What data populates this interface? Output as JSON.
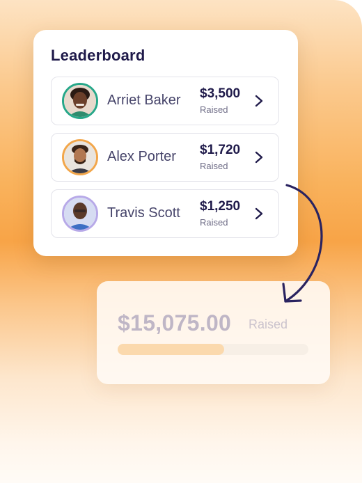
{
  "leaderboard": {
    "title": "Leaderboard",
    "entries": [
      {
        "name": "Arriet Baker",
        "amount": "$3,500",
        "label": "Raised",
        "ring_color": "#27a789"
      },
      {
        "name": "Alex Porter",
        "amount": "$1,720",
        "label": "Raised",
        "ring_color": "#f2a64a"
      },
      {
        "name": "Travis Scott",
        "amount": "$1,250",
        "label": "Raised",
        "ring_color": "#b7a9e8"
      }
    ]
  },
  "total": {
    "amount": "$15,075.00",
    "label": "Raised",
    "progress_fraction": 0.56
  },
  "colors": {
    "heading": "#1f1a4a",
    "name_text": "#46446a",
    "arrow": "#2a2360",
    "progress_fill": "#fbd9ad"
  }
}
